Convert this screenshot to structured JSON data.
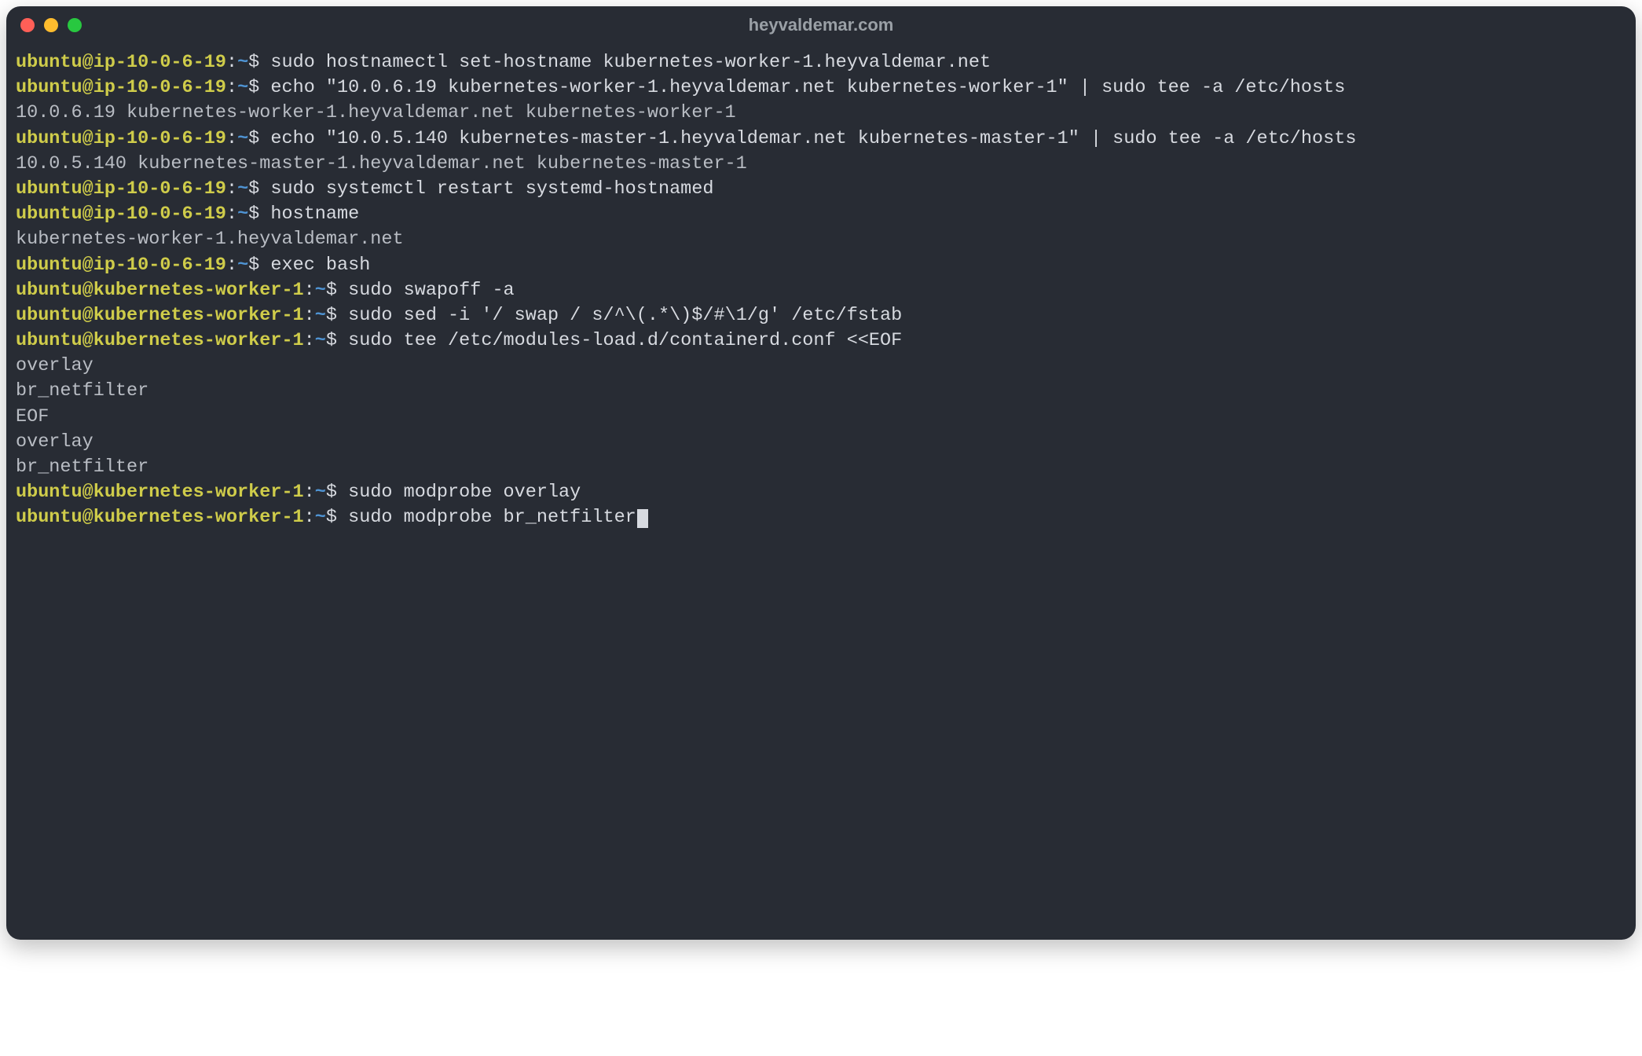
{
  "window": {
    "title": "heyvaldemar.com"
  },
  "colors": {
    "bg": "#282c34",
    "text": "#d7dae0",
    "host_yellow": "#cfcc4a",
    "path_blue": "#4f94d4",
    "traffic_red": "#ff5f57",
    "traffic_yellow": "#febc2e",
    "traffic_green": "#28c840"
  },
  "session": {
    "host_initial": "ubuntu@ip-10-0-6-19",
    "host_after": "ubuntu@kubernetes-worker-1",
    "sep": ":",
    "path": "~",
    "sigil": "$",
    "lines": [
      {
        "host": "ubuntu@ip-10-0-6-19",
        "cmd": "sudo hostnamectl set-hostname kubernetes-worker-1.heyvaldemar.net"
      },
      {
        "host": "ubuntu@ip-10-0-6-19",
        "cmd": "echo \"10.0.6.19 kubernetes-worker-1.heyvaldemar.net kubernetes-worker-1\" | sudo tee -a /etc/hosts"
      },
      {
        "out": "10.0.6.19 kubernetes-worker-1.heyvaldemar.net kubernetes-worker-1"
      },
      {
        "host": "ubuntu@ip-10-0-6-19",
        "cmd": "echo \"10.0.5.140 kubernetes-master-1.heyvaldemar.net kubernetes-master-1\" | sudo tee -a /etc/hosts"
      },
      {
        "out": "10.0.5.140 kubernetes-master-1.heyvaldemar.net kubernetes-master-1"
      },
      {
        "host": "ubuntu@ip-10-0-6-19",
        "cmd": "sudo systemctl restart systemd-hostnamed"
      },
      {
        "host": "ubuntu@ip-10-0-6-19",
        "cmd": "hostname"
      },
      {
        "out": "kubernetes-worker-1.heyvaldemar.net"
      },
      {
        "host": "ubuntu@ip-10-0-6-19",
        "cmd": "exec bash"
      },
      {
        "host": "ubuntu@kubernetes-worker-1",
        "cmd": "sudo swapoff -a"
      },
      {
        "host": "ubuntu@kubernetes-worker-1",
        "cmd": "sudo sed -i '/ swap / s/^\\(.*\\)$/#\\1/g' /etc/fstab"
      },
      {
        "host": "ubuntu@kubernetes-worker-1",
        "cmd": "sudo tee /etc/modules-load.d/containerd.conf <<EOF"
      },
      {
        "out": "overlay"
      },
      {
        "out": "br_netfilter"
      },
      {
        "out": "EOF"
      },
      {
        "out": "overlay"
      },
      {
        "out": "br_netfilter"
      },
      {
        "host": "ubuntu@kubernetes-worker-1",
        "cmd": "sudo modprobe overlay"
      },
      {
        "host": "ubuntu@kubernetes-worker-1",
        "cmd": "sudo modprobe br_netfilter",
        "cursor": true
      }
    ]
  }
}
